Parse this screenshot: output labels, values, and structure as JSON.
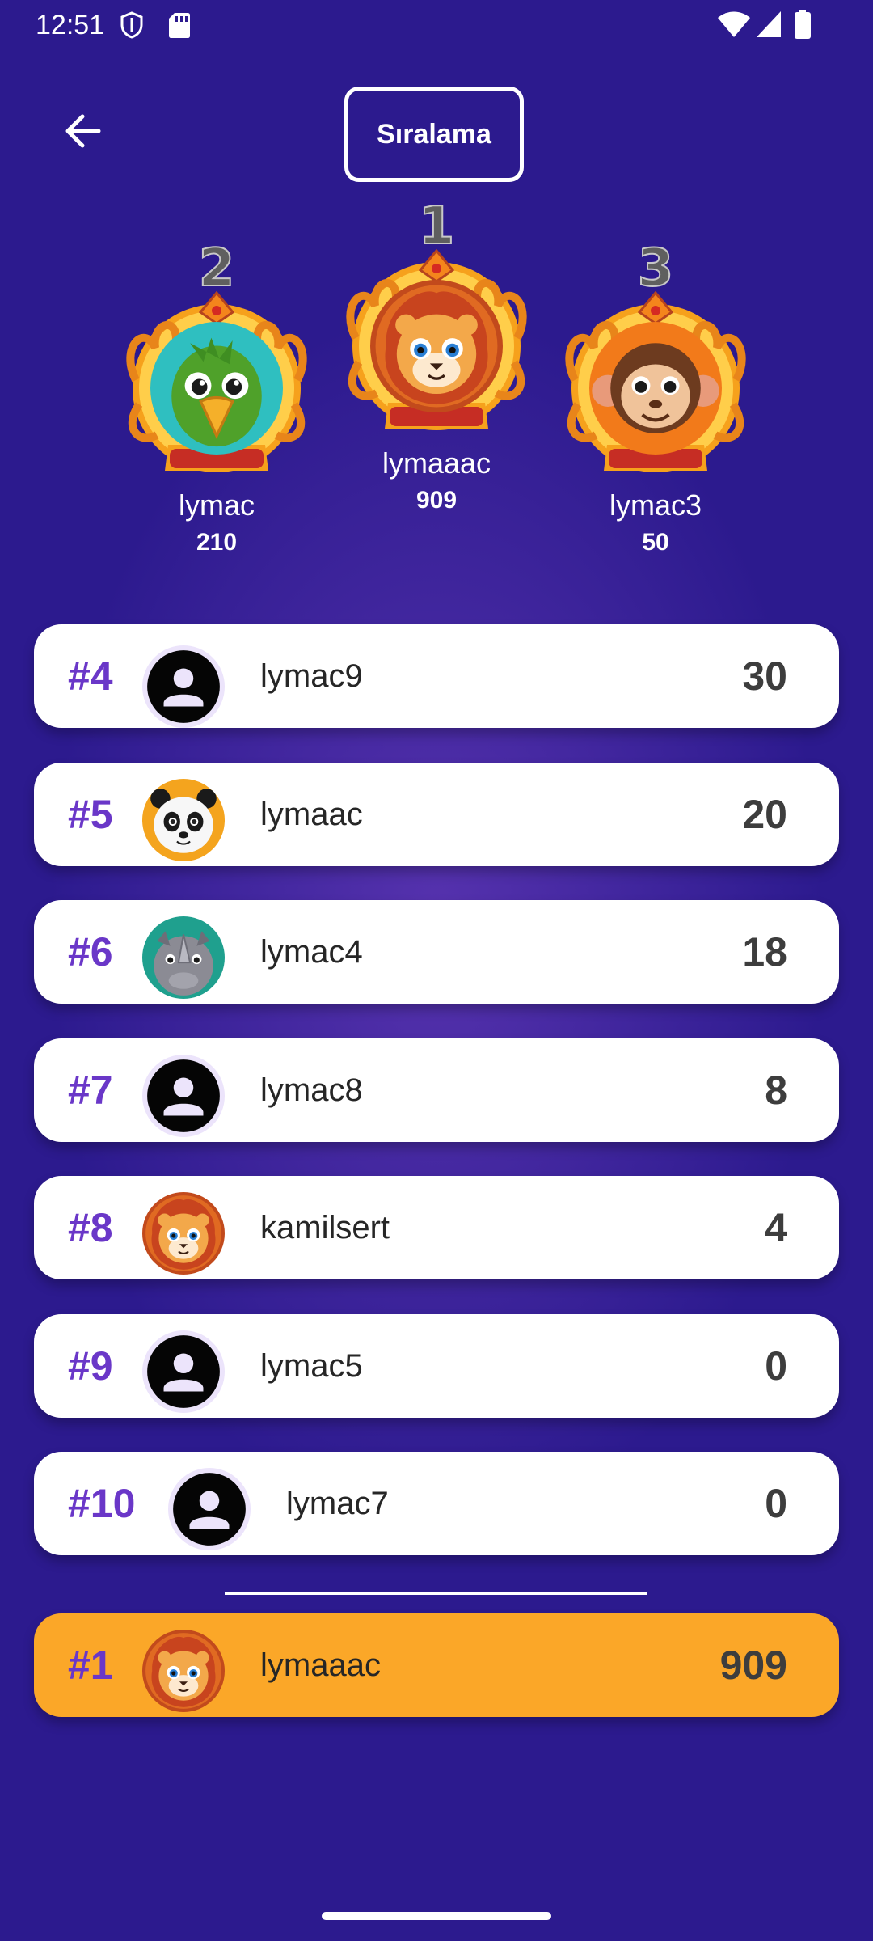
{
  "status_bar": {
    "time": "12:51"
  },
  "header": {
    "title": "Sıralama"
  },
  "podium": [
    {
      "rank": "2",
      "name": "lymac",
      "score": "210",
      "avatar": "parrot-avatar"
    },
    {
      "rank": "1",
      "name": "lymaaac",
      "score": "909",
      "avatar": "lion-avatar"
    },
    {
      "rank": "3",
      "name": "lymac3",
      "score": "50",
      "avatar": "monkey-avatar"
    }
  ],
  "list": [
    {
      "rank": "#4",
      "name": "lymac9",
      "score": "30",
      "avatar": "default-user-avatar"
    },
    {
      "rank": "#5",
      "name": "lymaac",
      "score": "20",
      "avatar": "panda-avatar"
    },
    {
      "rank": "#6",
      "name": "lymac4",
      "score": "18",
      "avatar": "rhino-avatar"
    },
    {
      "rank": "#7",
      "name": "lymac8",
      "score": "8",
      "avatar": "default-user-avatar"
    },
    {
      "rank": "#8",
      "name": "kamilsert",
      "score": "4",
      "avatar": "lion-avatar"
    },
    {
      "rank": "#9",
      "name": "lymac5",
      "score": "0",
      "avatar": "default-user-avatar"
    },
    {
      "rank": "#10",
      "name": "lymac7",
      "score": "0",
      "avatar": "default-user-avatar"
    }
  ],
  "current_user": {
    "rank": "#1",
    "name": "lymaaac",
    "score": "909",
    "avatar": "lion-avatar"
  },
  "colors": {
    "background": "#2c1a8e",
    "rank_text": "#6a37c8",
    "current_user_row": "#fba728",
    "row": "#ffffff"
  }
}
